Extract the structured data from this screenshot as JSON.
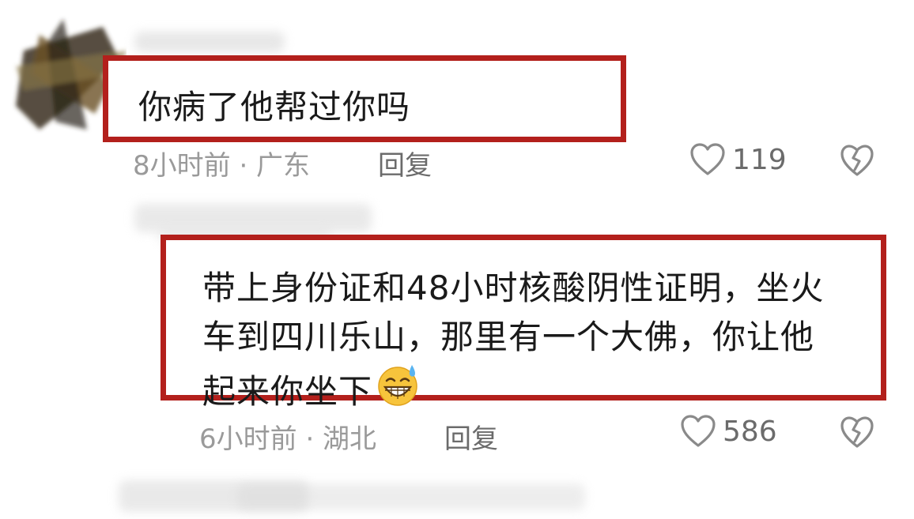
{
  "comments": [
    {
      "text": "你病了他帮过你吗",
      "time_location": "8小时前 · 广东",
      "reply_label": "回复",
      "likes": "119"
    },
    {
      "text_line1": "带上身份证和48小时核酸阴性证明，坐火",
      "text_line2": "车到四川乐山，那里有一个大佛，你让他",
      "text_line3": "起来你坐下",
      "time_location": "6小时前 · 湖北",
      "reply_label": "回复",
      "likes": "586"
    }
  ],
  "colors": {
    "highlight_border": "#b3201c",
    "meta_text": "#9a9a9a",
    "action_text": "#6b6b6b"
  },
  "icons": [
    "heart-outline-icon",
    "broken-heart-icon",
    "grinning-sweat-emoji"
  ]
}
